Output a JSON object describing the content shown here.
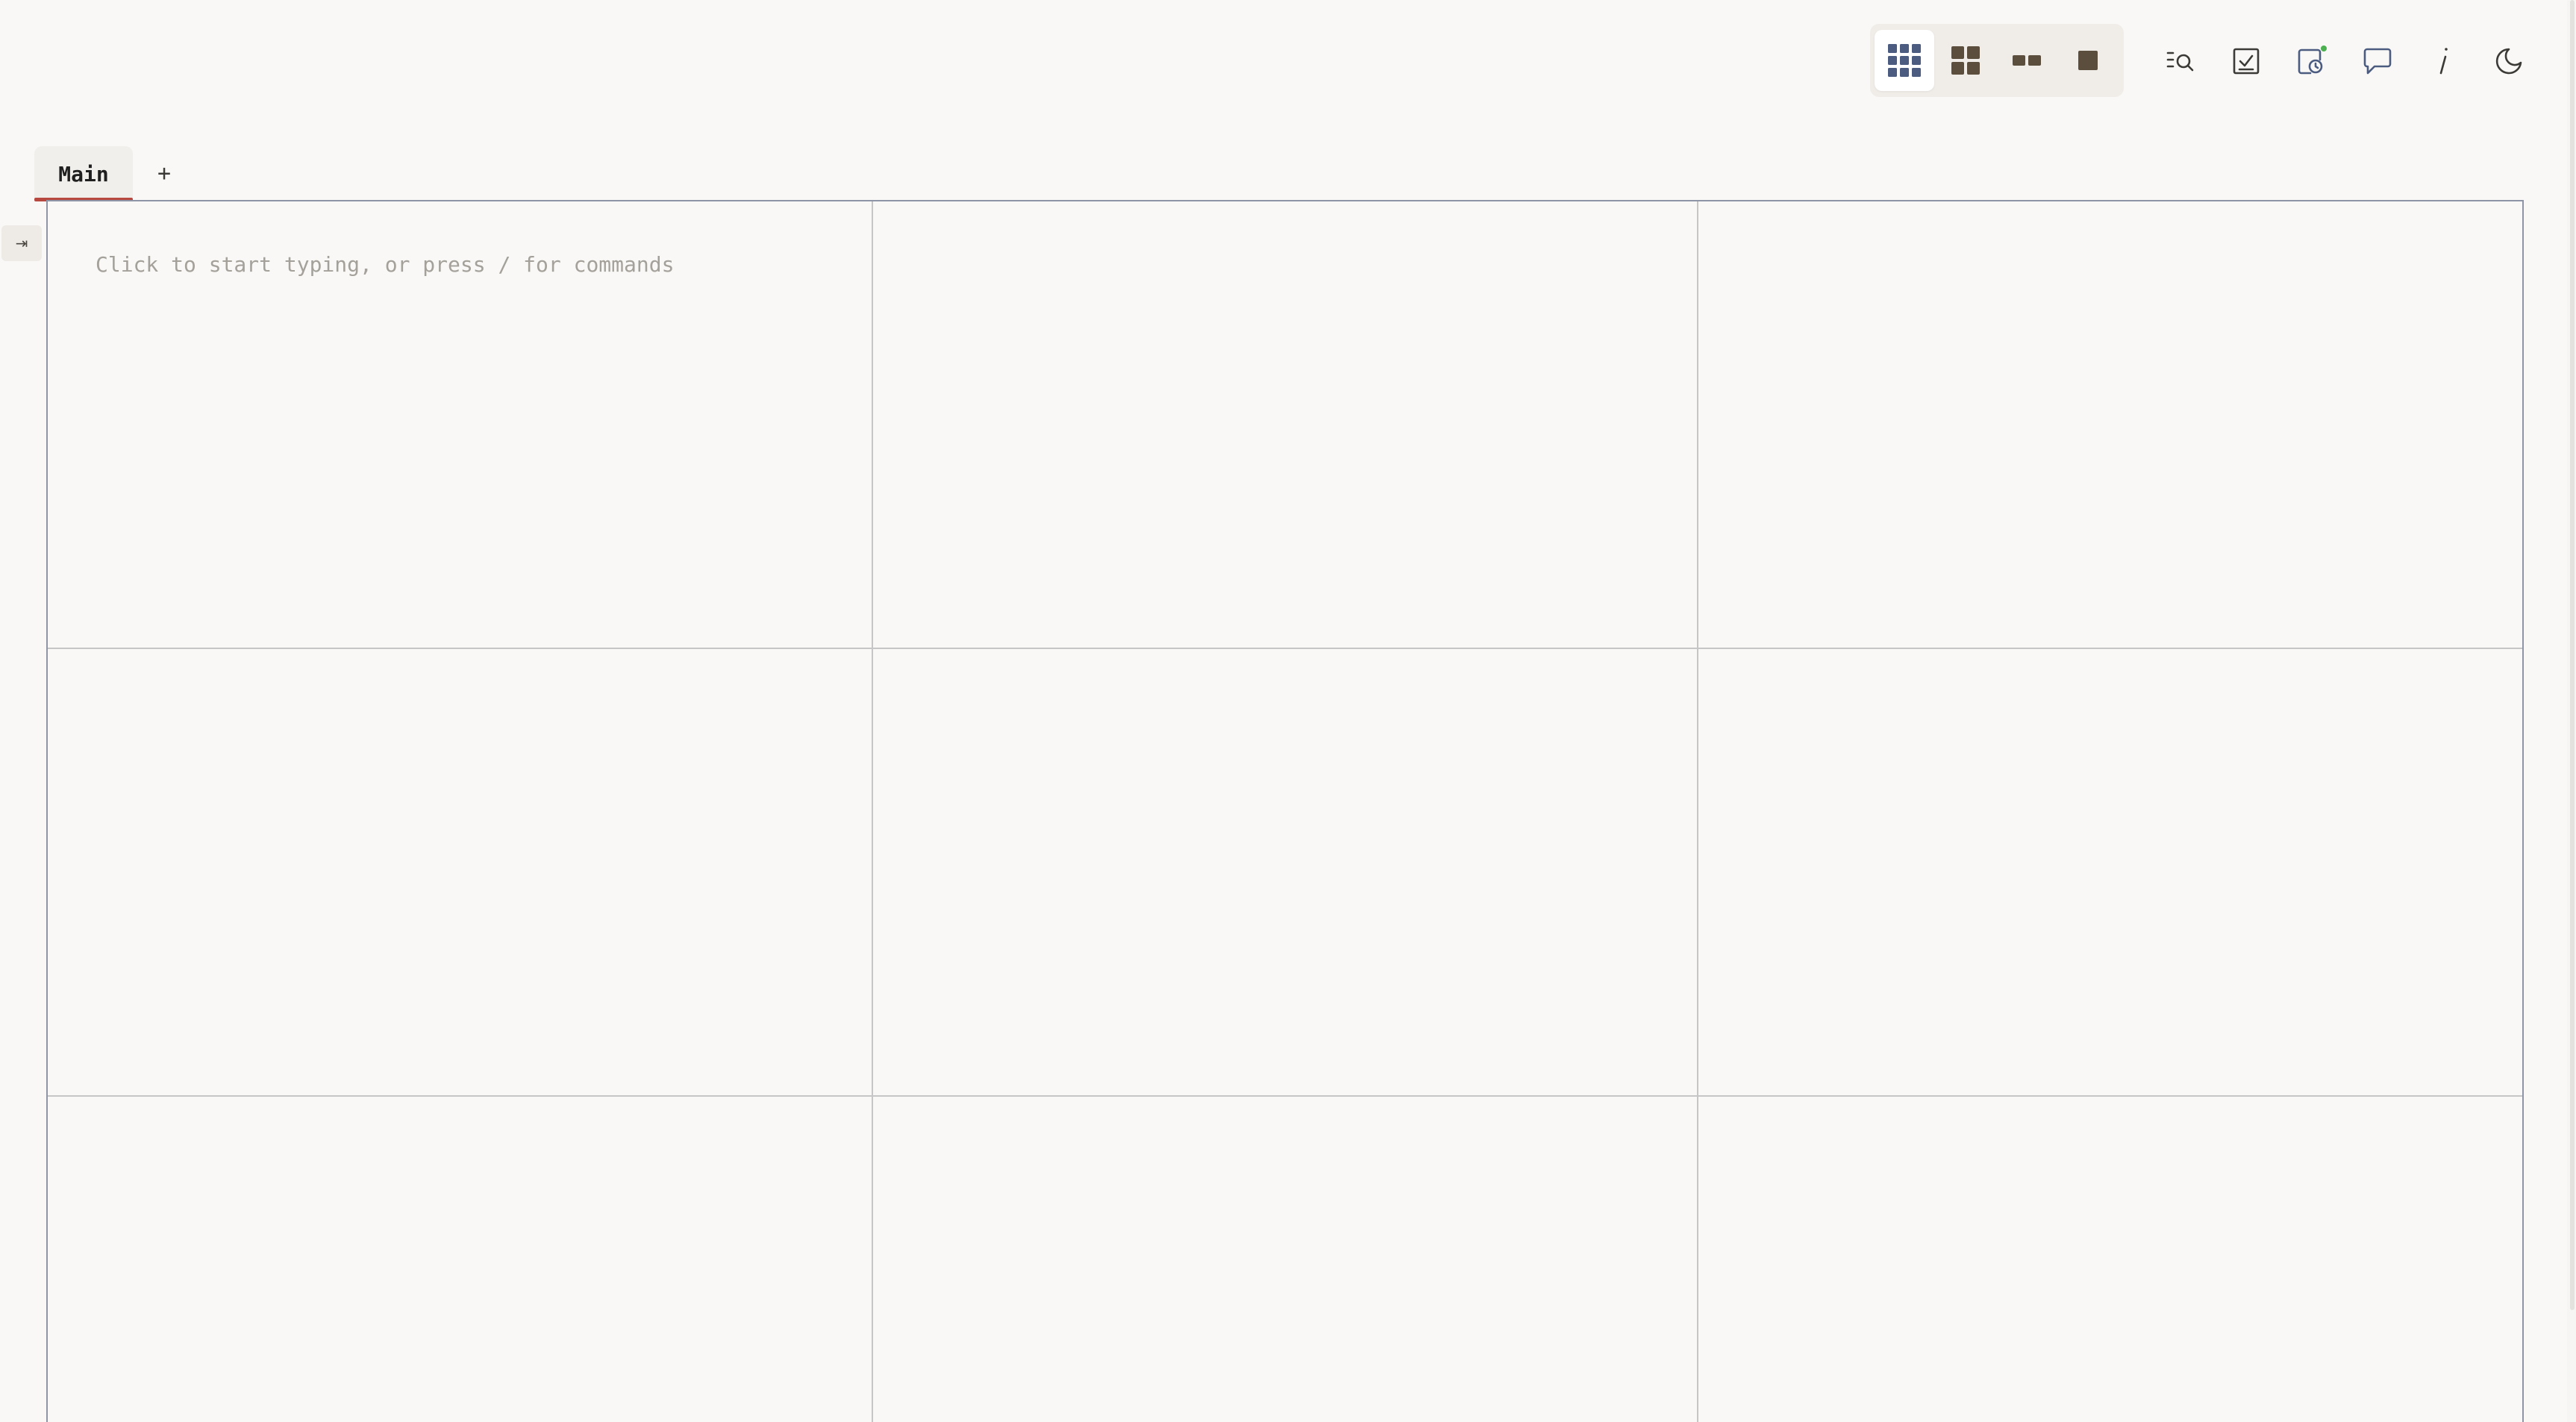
{
  "toolbar": {
    "layout_views": [
      {
        "name": "grid-3x3-view",
        "icon": "grid-3x3-icon",
        "active": true
      },
      {
        "name": "grid-2x2-view",
        "icon": "grid-2x2-icon",
        "active": false
      },
      {
        "name": "two-column-view",
        "icon": "two-column-icon",
        "active": false
      },
      {
        "name": "single-view",
        "icon": "single-square-icon",
        "active": false
      }
    ],
    "tools": [
      {
        "name": "search",
        "icon": "list-search-icon"
      },
      {
        "name": "tasks",
        "icon": "checkbox-icon"
      },
      {
        "name": "reminders",
        "icon": "calendar-clock-icon",
        "badge_color": "#4caf50"
      },
      {
        "name": "chat",
        "icon": "chat-bubble-icon"
      },
      {
        "name": "info",
        "icon": "info-italic-icon"
      },
      {
        "name": "dark-mode",
        "icon": "moon-icon"
      }
    ]
  },
  "tabs": {
    "items": [
      {
        "label": "Main",
        "active": true
      }
    ],
    "add_label": "+",
    "active_color": "#b6483f"
  },
  "sidebar_toggle": {
    "label": "⇥"
  },
  "grid": {
    "rows": 3,
    "columns": 3,
    "placeholder": "Click to start typing, or press / for commands",
    "border_color": "#8d95a6",
    "divider_color": "#c6c6c6"
  },
  "colors": {
    "background": "#f9f8f6",
    "icon": "#5b4e3d",
    "active_icon": "#4b5c80"
  }
}
